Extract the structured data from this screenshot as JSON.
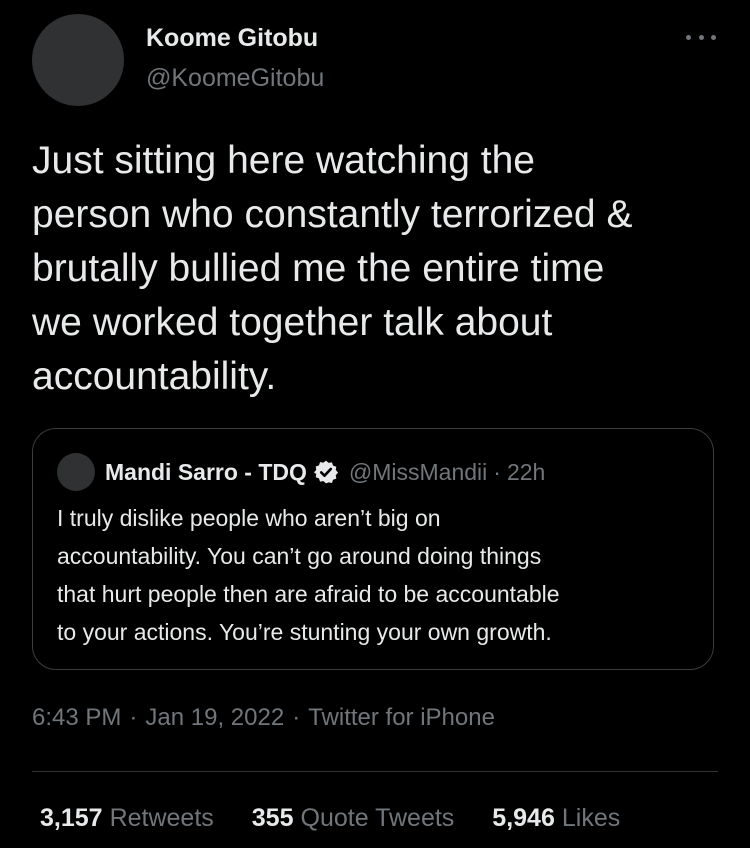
{
  "tweet": {
    "author_name": "Koome Gitobu",
    "author_handle": "@KoomeGitobu",
    "more_icon": "more-horizontal-icon",
    "text": "Just sitting here watching the\nperson who constantly terrorized &\nbrutally bullied me the entire time\nwe worked together talk about\naccountability.",
    "time": "6:43 PM",
    "date": "Jan 19, 2022",
    "source": "Twitter for iPhone"
  },
  "quote": {
    "author_name": "Mandi Sarro - TDQ",
    "verified_icon": "verified-badge-icon",
    "author_handle": "@MissMandii",
    "separator": "·",
    "time_ago": "22h",
    "text": "I truly dislike people who aren’t big on\naccountability. You can’t go around doing things\nthat hurt people then are afraid to be accountable\nto your actions. You’re stunting your own growth."
  },
  "meta_separator": "·",
  "stats": {
    "retweets_count": "3,157",
    "retweets_label": "Retweets",
    "quotes_count": "355",
    "quotes_label": "Quote Tweets",
    "likes_count": "5,946",
    "likes_label": "Likes"
  },
  "colors": {
    "background": "#000000",
    "text": "#e7e9ea",
    "secondary_text": "#71767b",
    "border": "#2f3336"
  }
}
